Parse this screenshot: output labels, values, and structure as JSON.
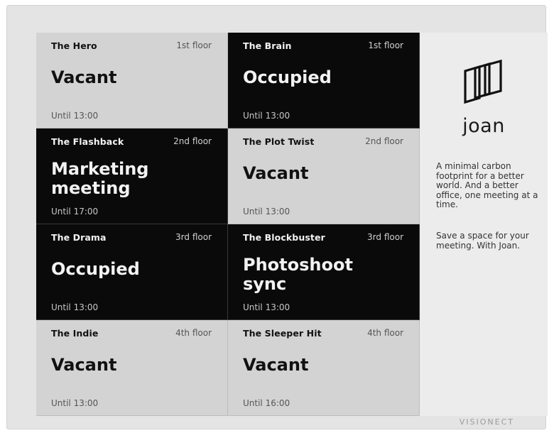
{
  "rooms": [
    {
      "name": "The Hero",
      "floor": "1st floor",
      "status": "Vacant",
      "until": "Until 13:00",
      "state": "vacant"
    },
    {
      "name": "The Brain",
      "floor": "1st floor",
      "status": "Occupied",
      "until": "Until 13:00",
      "state": "occupied"
    },
    {
      "name": "The Flashback",
      "floor": "2nd floor",
      "status": "Marketing meeting",
      "until": "Until 17:00",
      "state": "occupied"
    },
    {
      "name": "The Plot Twist",
      "floor": "2nd floor",
      "status": "Vacant",
      "until": "Until 13:00",
      "state": "vacant"
    },
    {
      "name": "The Drama",
      "floor": "3rd floor",
      "status": "Occupied",
      "until": "Until 13:00",
      "state": "occupied"
    },
    {
      "name": "The Blockbuster",
      "floor": "3rd floor",
      "status": "Photoshoot sync",
      "until": "Until 13:00",
      "state": "occupied"
    },
    {
      "name": "The Indie",
      "floor": "4th floor",
      "status": "Vacant",
      "until": "Until 13:00",
      "state": "vacant"
    },
    {
      "name": "The Sleeper Hit",
      "floor": "4th floor",
      "status": "Vacant",
      "until": "Until 16:00",
      "state": "vacant"
    }
  ],
  "sidebar": {
    "logo_icon": "joan-logo-icon",
    "logo_text": "joan",
    "tagline": "A minimal carbon footprint for a better world. And a better office, one meeting at a time.",
    "cta": "Save a space for your meeting. With Joan."
  },
  "device": {
    "brand": "VISIONECT"
  },
  "colors": {
    "vacant_bg": "#d3d3d3",
    "occupied_bg": "#0a0a0a",
    "panel_bg": "#ececec"
  }
}
